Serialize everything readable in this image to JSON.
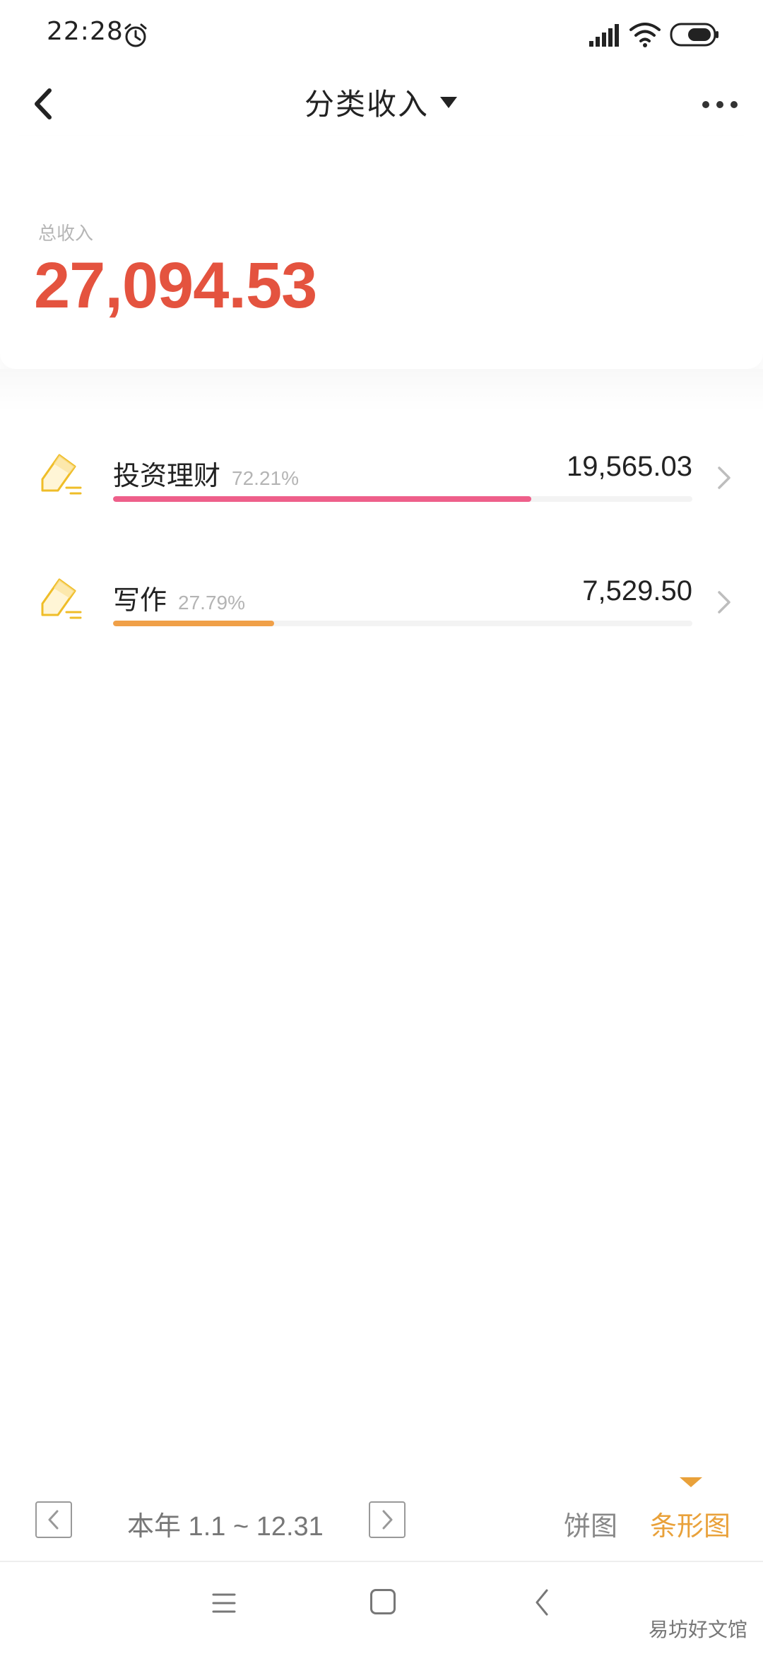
{
  "status_bar": {
    "time": "22:28"
  },
  "header": {
    "title": "分类收入"
  },
  "summary": {
    "label": "总收入",
    "value": "27,094.53"
  },
  "items": [
    {
      "name": "投资理财",
      "percent": "72.21%",
      "amount": "19,565.03",
      "fraction": 0.7221,
      "color": "#ee5f8a"
    },
    {
      "name": "写作",
      "percent": "27.79%",
      "amount": "7,529.50",
      "fraction": 0.2779,
      "color": "#f0a048"
    }
  ],
  "bottom_bar": {
    "range": "本年 1.1 ~ 12.31",
    "tab_pie": "饼图",
    "tab_bar": "条形图",
    "active_tab": "条形图"
  },
  "watermark": "易坊好文馆",
  "colors": {
    "accent": "#e9a13a",
    "total": "#e4533f",
    "icon": "#efbd28"
  }
}
